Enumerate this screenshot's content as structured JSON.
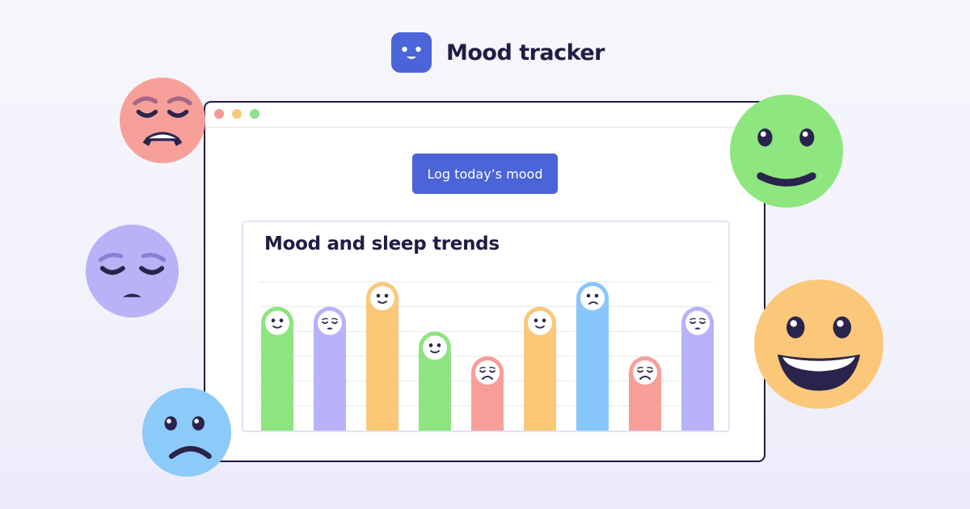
{
  "brand": {
    "name": "Mood tracker",
    "logo_icon": "smiling-face-icon",
    "logo_color": "#4b64d8"
  },
  "window": {
    "traffic_lights": [
      "#f59a95",
      "#f8c77a",
      "#8fe08c"
    ]
  },
  "log_button": {
    "label": "Log today’s mood",
    "color": "#4b64d8"
  },
  "chart_data": {
    "type": "bar",
    "title": "Mood and sleep trends",
    "xlabel": "",
    "ylabel": "",
    "ylim": [
      0,
      6
    ],
    "grid": true,
    "categories": [
      "",
      "",
      "",
      "",
      "",
      "",
      "",
      "",
      ""
    ],
    "values": [
      5,
      5,
      6,
      4,
      3,
      5,
      6,
      3,
      5
    ],
    "moods": [
      "content",
      "tired",
      "happy",
      "content",
      "distressed",
      "happy",
      "sad",
      "distressed",
      "tired"
    ],
    "colors": [
      "#8ee47e",
      "#b7b2f9",
      "#fbc878",
      "#8ee47e",
      "#f89e98",
      "#fbc878",
      "#88c7fb",
      "#f89e98",
      "#b7b2f9"
    ]
  },
  "floating_faces": [
    {
      "name": "distressed-face-icon",
      "color": "#f7a09a"
    },
    {
      "name": "tired-face-icon",
      "color": "#b8b2f7"
    },
    {
      "name": "sad-face-icon",
      "color": "#8ccafa"
    },
    {
      "name": "smiling-face-icon",
      "color": "#8de67e"
    },
    {
      "name": "grinning-face-icon",
      "color": "#fbc87a"
    }
  ]
}
